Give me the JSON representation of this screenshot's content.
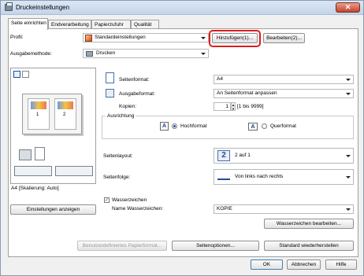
{
  "window": {
    "title": "Druckeinstellungen",
    "close_glyph": "✕"
  },
  "tabs": [
    {
      "label": "Seite einrichten",
      "active": true
    },
    {
      "label": "Endverarbeitung"
    },
    {
      "label": "Papierzufuhr"
    },
    {
      "label": "Qualität"
    }
  ],
  "profile": {
    "label": "Profil:",
    "value": "Standardeinstellungen",
    "add_button": "Hinzufügen(1)...",
    "edit_button": "Bearbeiten(2)..."
  },
  "output_method": {
    "label": "Ausgabemethode:",
    "value": "Drucken"
  },
  "preview": {
    "status": "A4 [Skalierung: Auto]",
    "show_settings_button": "Einstellungen anzeigen",
    "page_numbers": [
      "1",
      "2"
    ]
  },
  "page_size": {
    "label": "Seitenformat:",
    "value": "A4"
  },
  "output_size": {
    "label": "Ausgabeformat:",
    "value": "An Seitenformat anpassen"
  },
  "copies": {
    "label": "Kopien:",
    "value": "1",
    "range": "[1 bis 9999]"
  },
  "orientation": {
    "group_label": "Ausrichtung",
    "portrait": "Hochformat",
    "landscape": "Querformat",
    "selected": "portrait",
    "icon_letter": "A"
  },
  "page_layout": {
    "label": "Seitenlayout:",
    "icon_text": "2",
    "value": "2 auf 1"
  },
  "page_order": {
    "label": "Seitenfolge:",
    "value": "Von links nach rechts"
  },
  "watermark": {
    "checkbox_label": "Wasserzeichen",
    "checked": true,
    "check_glyph": "✓",
    "name_label": "Name Wasserzeichen:",
    "name_value": "KOPIE",
    "edit_button": "Wasserzeichen bearbeiten..."
  },
  "bottom_buttons": {
    "custom_paper": "Benutzerdefiniertes Papierformat...",
    "page_options": "Seitenoptionen...",
    "restore_defaults": "Standard wiederherstellen"
  },
  "dialog_buttons": {
    "ok": "OK",
    "cancel": "Abbrechen",
    "help": "Hilfe"
  },
  "colors": {
    "highlight": "#e01b1b",
    "accent": "#1a4fa8",
    "titlebar": "#c3d4ea"
  }
}
